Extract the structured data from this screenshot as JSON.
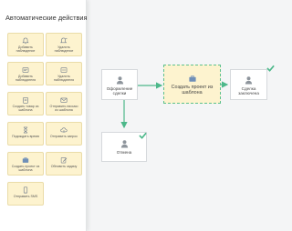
{
  "sidebar": {
    "title": "Автоматические действия",
    "actions": [
      {
        "label": "Добавить наблюдение",
        "icon": "bell-icon"
      },
      {
        "label": "Удалить наблюдение",
        "icon": "bell-minus-icon"
      },
      {
        "label": "Добавить наблюдателя",
        "icon": "add-watcher-icon"
      },
      {
        "label": "Удалить наблюдателя",
        "icon": "remove-watcher-icon"
      },
      {
        "label": "Создать товар из шаблона",
        "icon": "clipboard-icon"
      },
      {
        "label": "Отправить письмо из шаблона",
        "icon": "envelope-icon"
      },
      {
        "label": "Подождать время",
        "icon": "hourglass-icon"
      },
      {
        "label": "Отправить запрос",
        "icon": "cloud-upload-icon"
      },
      {
        "label": "Создать проект из шаблона",
        "icon": "briefcase-icon"
      },
      {
        "label": "Обновить задачу",
        "icon": "edit-task-icon"
      },
      {
        "label": "Отправить SMS",
        "icon": "phone-icon"
      }
    ]
  },
  "flow": {
    "nodes": {
      "deal": {
        "label": "Оформление сделки",
        "icon": "person-icon"
      },
      "project": {
        "label": "Создать проект из шаблона",
        "icon": "briefcase-icon"
      },
      "done": {
        "label": "Сделка заключена",
        "icon": "person-icon",
        "status": "completed"
      },
      "cancel": {
        "label": "Отмена",
        "icon": "person-icon",
        "status": "completed"
      }
    }
  },
  "colors": {
    "action_bg": "#fdf3cf",
    "accent_green": "#4cb88a",
    "active_border": "#5cc08c"
  }
}
